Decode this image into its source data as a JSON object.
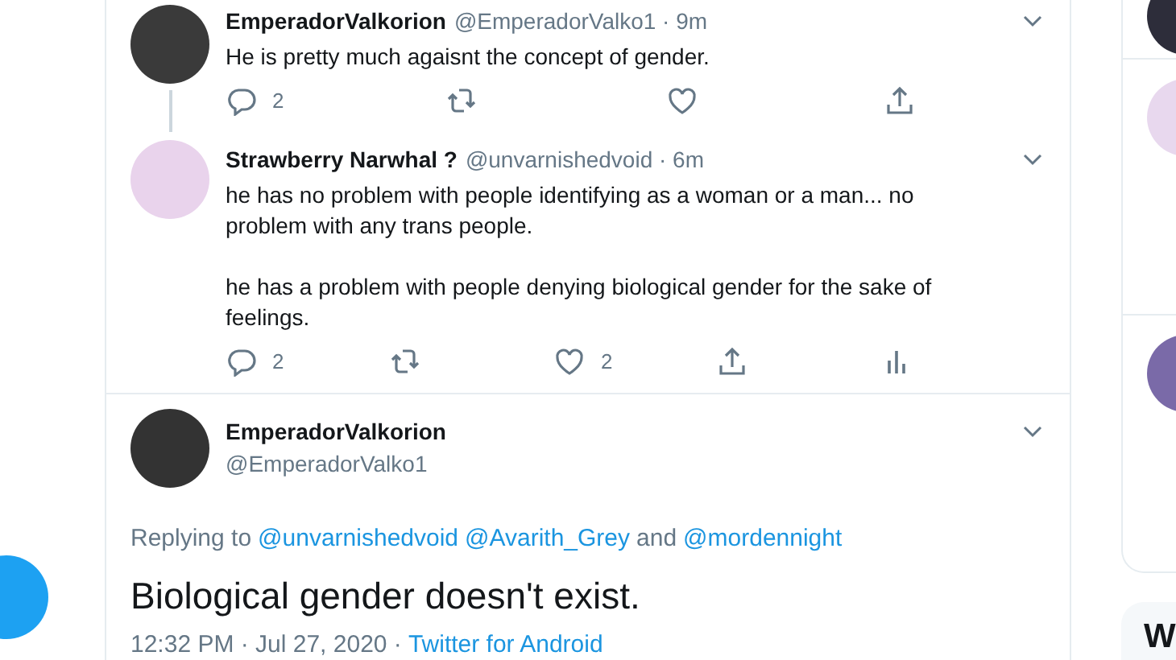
{
  "thread": [
    {
      "name": "EmperadorValkorion",
      "handle_time": "@EmperadorValko1 · 9m",
      "text": "He is pretty much agaisnt the concept of gender.",
      "thread_line": true,
      "actions": [
        {
          "kind": "reply",
          "count": "2"
        },
        {
          "kind": "retweet"
        },
        {
          "kind": "like"
        },
        {
          "kind": "share"
        }
      ]
    },
    {
      "name": "Strawberry Narwhal ?",
      "handle_time": "@unvarnishedvoid · 6m",
      "text": "he has no problem with people identifying as a woman or a man... no problem with any trans people.\n\nhe has a problem with people denying biological gender for the sake of feelings.",
      "thread_line": false,
      "actions": [
        {
          "kind": "reply",
          "count": "2"
        },
        {
          "kind": "retweet"
        },
        {
          "kind": "like",
          "count": "2"
        },
        {
          "kind": "share"
        },
        {
          "kind": "analytics"
        }
      ]
    }
  ],
  "focused": {
    "name": "EmperadorValkorion",
    "handle": "@EmperadorValko1",
    "replying": [
      {
        "text": "Replying to",
        "link": false
      },
      {
        "text": "@unvarnishedvoid",
        "link": true
      },
      {
        "text": "@Avarith_Grey",
        "link": true
      },
      {
        "text": "and",
        "link": false
      },
      {
        "text": "@mordennight",
        "link": true
      }
    ],
    "text": "Biological gender doesn't exist.",
    "timestamp": "12:32 PM · Jul 27, 2020 ·",
    "source": "Twitter for Android"
  },
  "sidebar": {
    "heading": "W"
  }
}
